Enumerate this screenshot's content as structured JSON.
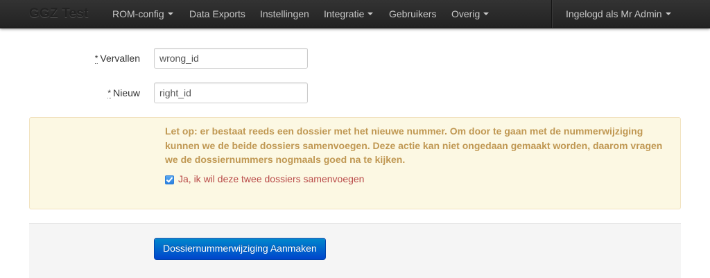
{
  "navbar": {
    "brand": "GGZ Test",
    "items": [
      {
        "label": "ROM-config",
        "dropdown": true
      },
      {
        "label": "Data Exports",
        "dropdown": false
      },
      {
        "label": "Instellingen",
        "dropdown": false
      },
      {
        "label": "Integratie",
        "dropdown": true
      },
      {
        "label": "Gebruikers",
        "dropdown": false
      },
      {
        "label": "Overig",
        "dropdown": true
      }
    ],
    "user_menu": {
      "label": "Ingelogd als Mr Admin",
      "dropdown": true
    }
  },
  "form": {
    "fields": [
      {
        "required_marker": "*",
        "label": "Vervallen",
        "value": "wrong_id"
      },
      {
        "required_marker": "*",
        "label": "Nieuw",
        "value": "right_id"
      }
    ],
    "warning": {
      "message": "Let op: er bestaat reeds een dossier met het nieuwe nummer. Om door te gaan met de nummerwijziging kunnen we de beide dossiers samenvoegen. Deze actie kan niet ongedaan gemaakt worden, daarom vragen we de dossiernummers nogmaals goed na te kijken.",
      "confirm_label": "Ja, ik wil deze twee dossiers samenvoegen",
      "confirm_checked": true
    },
    "submit_label": "Dossiernummerwijziging Aanmaken"
  },
  "colors": {
    "navbar_bg": "#222222",
    "warning_text": "#c09853",
    "error_text": "#b94a48",
    "primary_button": "#0055cc"
  }
}
